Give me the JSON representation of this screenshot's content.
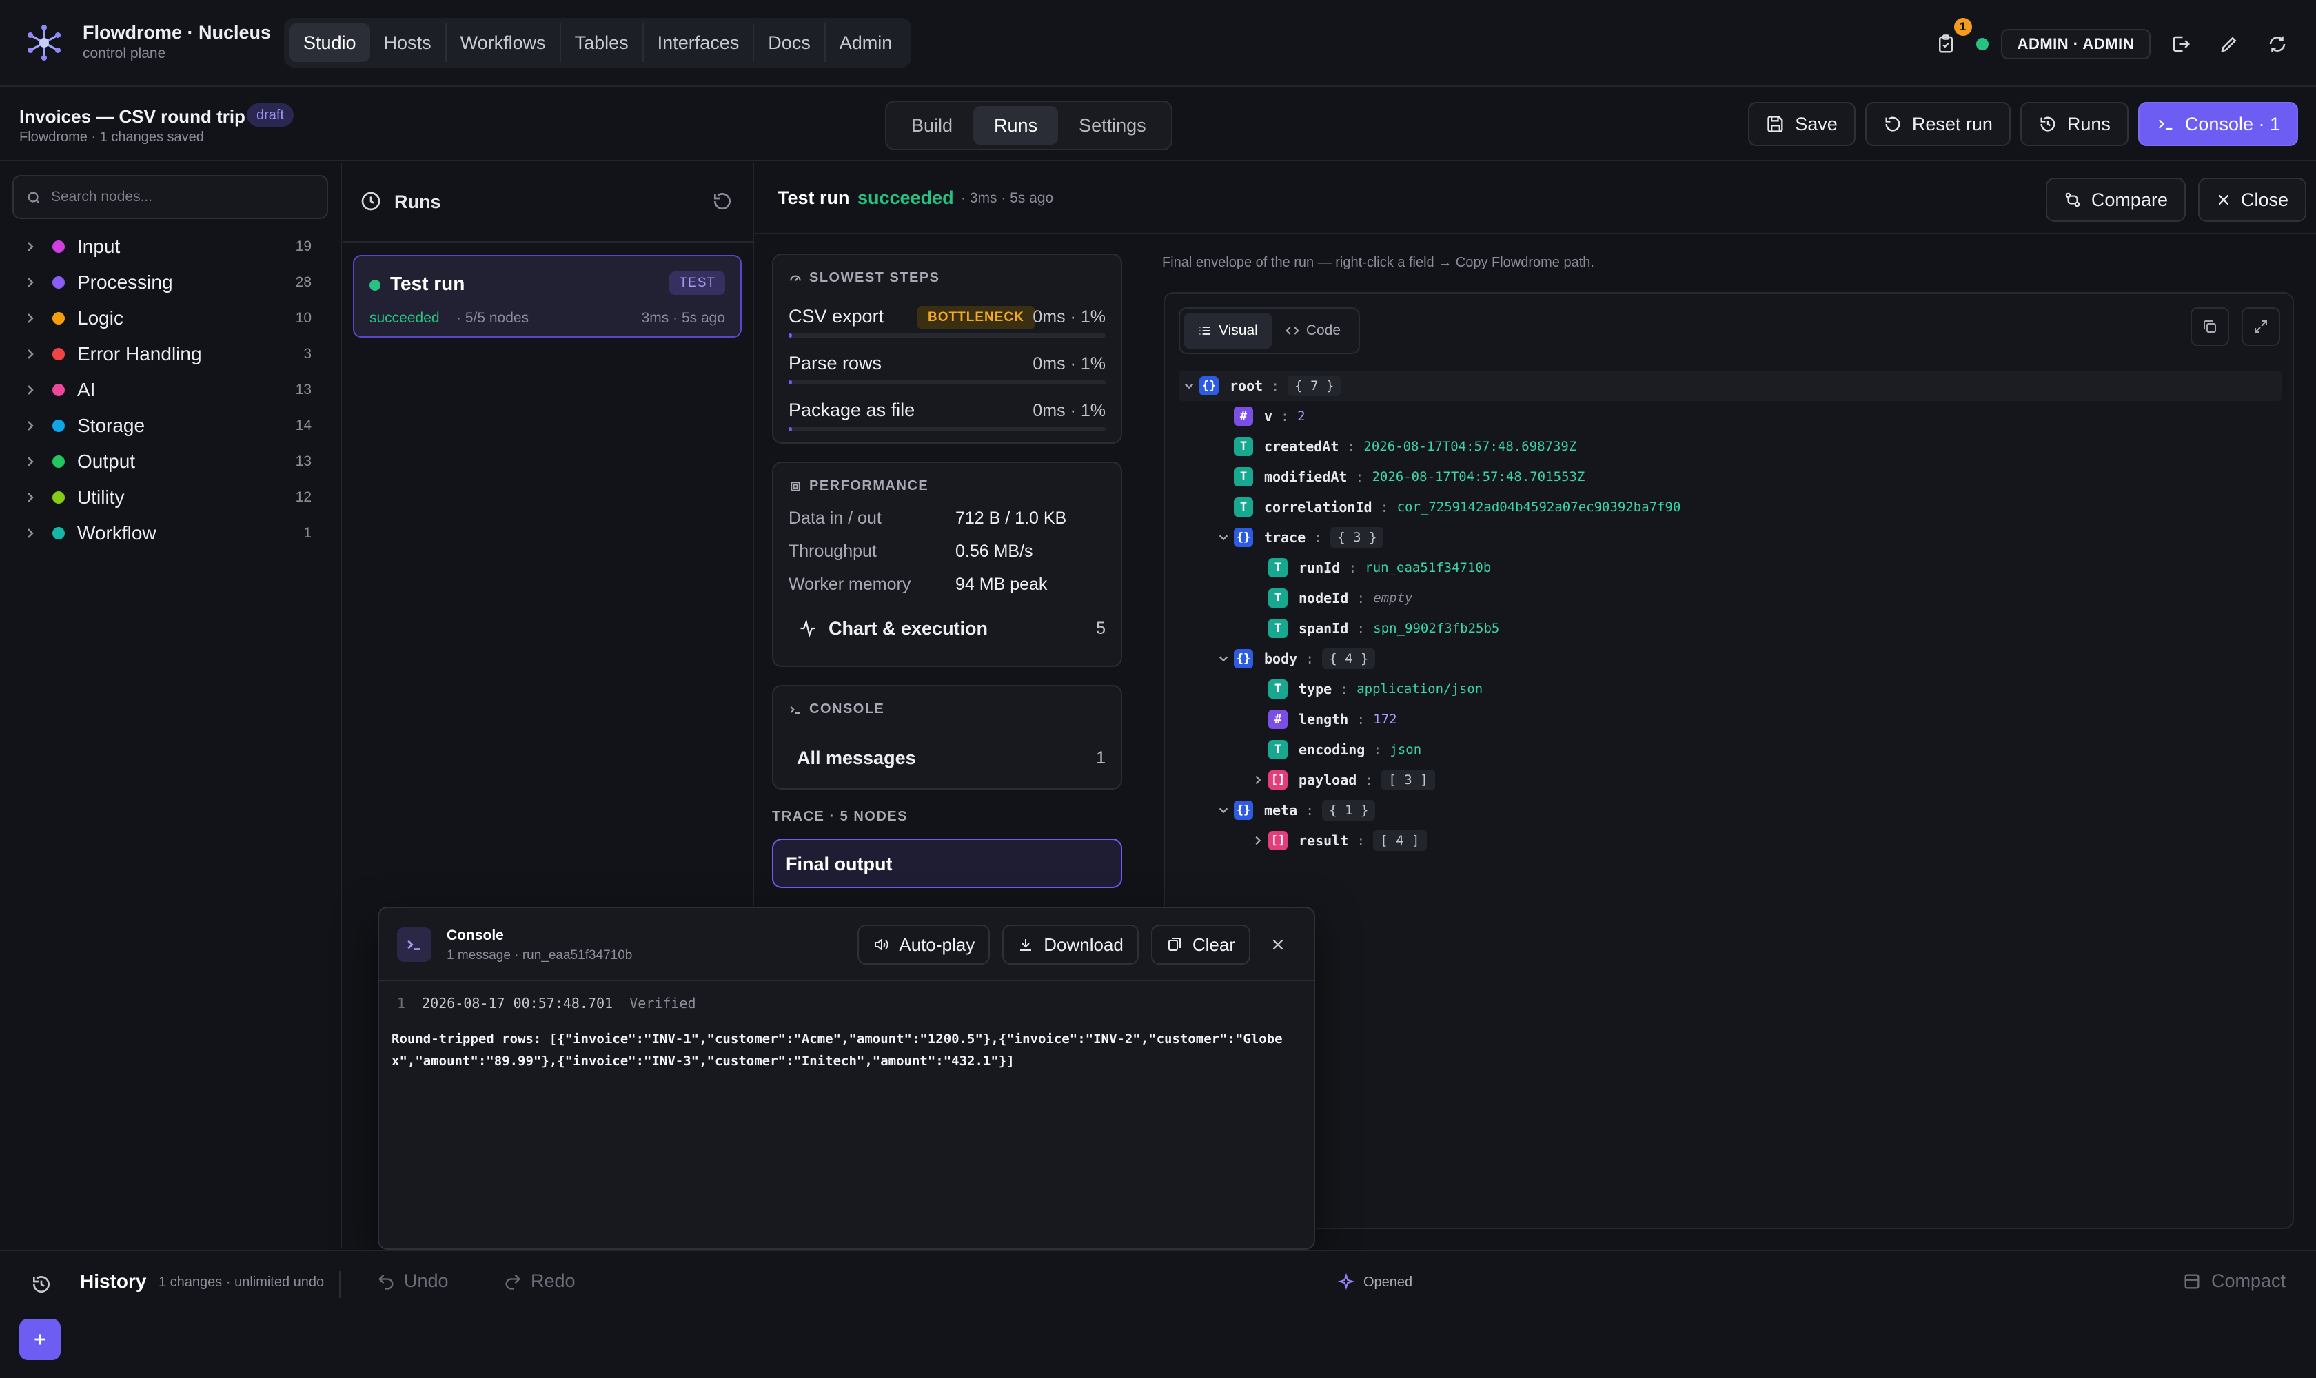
{
  "app": {
    "title": "Flowdrome · Nucleus",
    "subtitle": "control plane",
    "nav": [
      "Studio",
      "Hosts",
      "Workflows",
      "Tables",
      "Interfaces",
      "Docs",
      "Admin"
    ],
    "notifications_count": "1",
    "user": "ADMIN · ADMIN"
  },
  "project": {
    "title": "Invoices — CSV round trip",
    "status": "draft",
    "subtitle": "Flowdrome · 1 changes saved",
    "mode_tabs": [
      "Build",
      "Runs",
      "Settings"
    ],
    "actions": {
      "save": "Save",
      "reset": "Reset run",
      "runs": "Runs",
      "console": "Console · 1"
    }
  },
  "sidebar": {
    "search_placeholder": "Search nodes...",
    "categories": [
      {
        "label": "Input",
        "count": "19",
        "color": "#d13fe0"
      },
      {
        "label": "Processing",
        "count": "28",
        "color": "#8b5cf6"
      },
      {
        "label": "Logic",
        "count": "10",
        "color": "#f59e0b"
      },
      {
        "label": "Error Handling",
        "count": "3",
        "color": "#ef4444"
      },
      {
        "label": "AI",
        "count": "13",
        "color": "#ec4899"
      },
      {
        "label": "Storage",
        "count": "14",
        "color": "#0ea5e9"
      },
      {
        "label": "Output",
        "count": "13",
        "color": "#22c55e"
      },
      {
        "label": "Utility",
        "count": "12",
        "color": "#84cc16"
      },
      {
        "label": "Workflow",
        "count": "1",
        "color": "#14b8a6"
      }
    ]
  },
  "runs_panel": {
    "title": "Runs",
    "run": {
      "title": "Test run",
      "badge": "TEST",
      "status": "succeeded",
      "nodes": "· 5/5 nodes",
      "time": "3ms · 5s ago"
    }
  },
  "detail": {
    "title": "Test run",
    "status": "succeeded",
    "time": "· 3ms · 5s ago",
    "compare": "Compare",
    "close": "Close",
    "slowest_steps": {
      "header": "SLOWEST STEPS",
      "bottleneck_label": "BOTTLENECK",
      "steps": [
        {
          "name": "CSV export",
          "value": "0ms · 1%",
          "share": 0.01
        },
        {
          "name": "Parse rows",
          "value": "0ms · 1%",
          "share": 0.01
        },
        {
          "name": "Package as file",
          "value": "0ms · 1%",
          "share": 0.01
        }
      ]
    },
    "performance": {
      "header": "PERFORMANCE",
      "rows": [
        {
          "k": "Data in / out",
          "v": "712 B / 1.0 KB"
        },
        {
          "k": "Throughput",
          "v": "0.56 MB/s"
        },
        {
          "k": "Worker memory",
          "v": "94 MB peak"
        }
      ],
      "chart_label": "Chart & execution",
      "chart_count": "5"
    },
    "console_card": {
      "header": "CONSOLE",
      "label": "All messages",
      "count": "1"
    },
    "trace": {
      "header": "TRACE · 5 NODES",
      "item": "Final output"
    },
    "viewer": {
      "hint": "Final envelope of the run — right-click a field → Copy Flowdrome path.",
      "tabs": [
        "Visual",
        "Code"
      ],
      "tree": [
        {
          "depth": 0,
          "chev": "down",
          "type": "obj",
          "key": "root",
          "pill": "{ 7 }"
        },
        {
          "depth": 1,
          "type": "num",
          "key": "v",
          "val": "2",
          "vt": "num"
        },
        {
          "depth": 1,
          "type": "str",
          "key": "createdAt",
          "val": "2026-08-17T04:57:48.698739Z"
        },
        {
          "depth": 1,
          "type": "str",
          "key": "modifiedAt",
          "val": "2026-08-17T04:57:48.701553Z"
        },
        {
          "depth": 1,
          "type": "str",
          "key": "correlationId",
          "val": "cor_7259142ad04b4592a07ec90392ba7f90"
        },
        {
          "depth": 1,
          "chev": "down",
          "type": "obj",
          "key": "trace",
          "pill": "{ 3 }"
        },
        {
          "depth": 2,
          "type": "str",
          "key": "runId",
          "val": "run_eaa51f34710b"
        },
        {
          "depth": 2,
          "type": "str",
          "key": "nodeId",
          "val": "empty",
          "vt": "empty"
        },
        {
          "depth": 2,
          "type": "str",
          "key": "spanId",
          "val": "spn_9902f3fb25b5"
        },
        {
          "depth": 1,
          "chev": "down",
          "type": "obj",
          "key": "body",
          "pill": "{ 4 }"
        },
        {
          "depth": 2,
          "type": "str",
          "key": "type",
          "val": "application/json"
        },
        {
          "depth": 2,
          "type": "num",
          "key": "length",
          "val": "172",
          "vt": "num"
        },
        {
          "depth": 2,
          "type": "str",
          "key": "encoding",
          "val": "json"
        },
        {
          "depth": 2,
          "chev": "right",
          "type": "arr",
          "key": "payload",
          "pill": "[ 3 ]"
        },
        {
          "depth": 1,
          "chev": "down",
          "type": "obj",
          "key": "meta",
          "pill": "{ 1 }"
        },
        {
          "depth": 2,
          "chev": "right",
          "type": "arr",
          "key": "result",
          "pill": "[ 4 ]"
        }
      ]
    }
  },
  "console": {
    "title": "Console",
    "subtitle": "1 message · run_eaa51f34710b",
    "autoplay": "Auto-play",
    "download": "Download",
    "clear": "Clear",
    "log": {
      "index": "1",
      "timestamp": "2026-08-17 00:57:48.701",
      "level": "Verified",
      "message": "Round-tripped rows: [{\"invoice\":\"INV-1\",\"customer\":\"Acme\",\"amount\":\"1200.5\"},{\"invoice\":\"INV-2\",\"customer\":\"Globex\",\"amount\":\"89.99\"},{\"invoice\":\"INV-3\",\"customer\":\"Initech\",\"amount\":\"432.1\"}]"
    }
  },
  "footer": {
    "history": "History",
    "changes": "1 changes · unlimited undo",
    "undo": "Undo",
    "redo": "Redo",
    "opened": "Opened",
    "compact": "Compact"
  }
}
